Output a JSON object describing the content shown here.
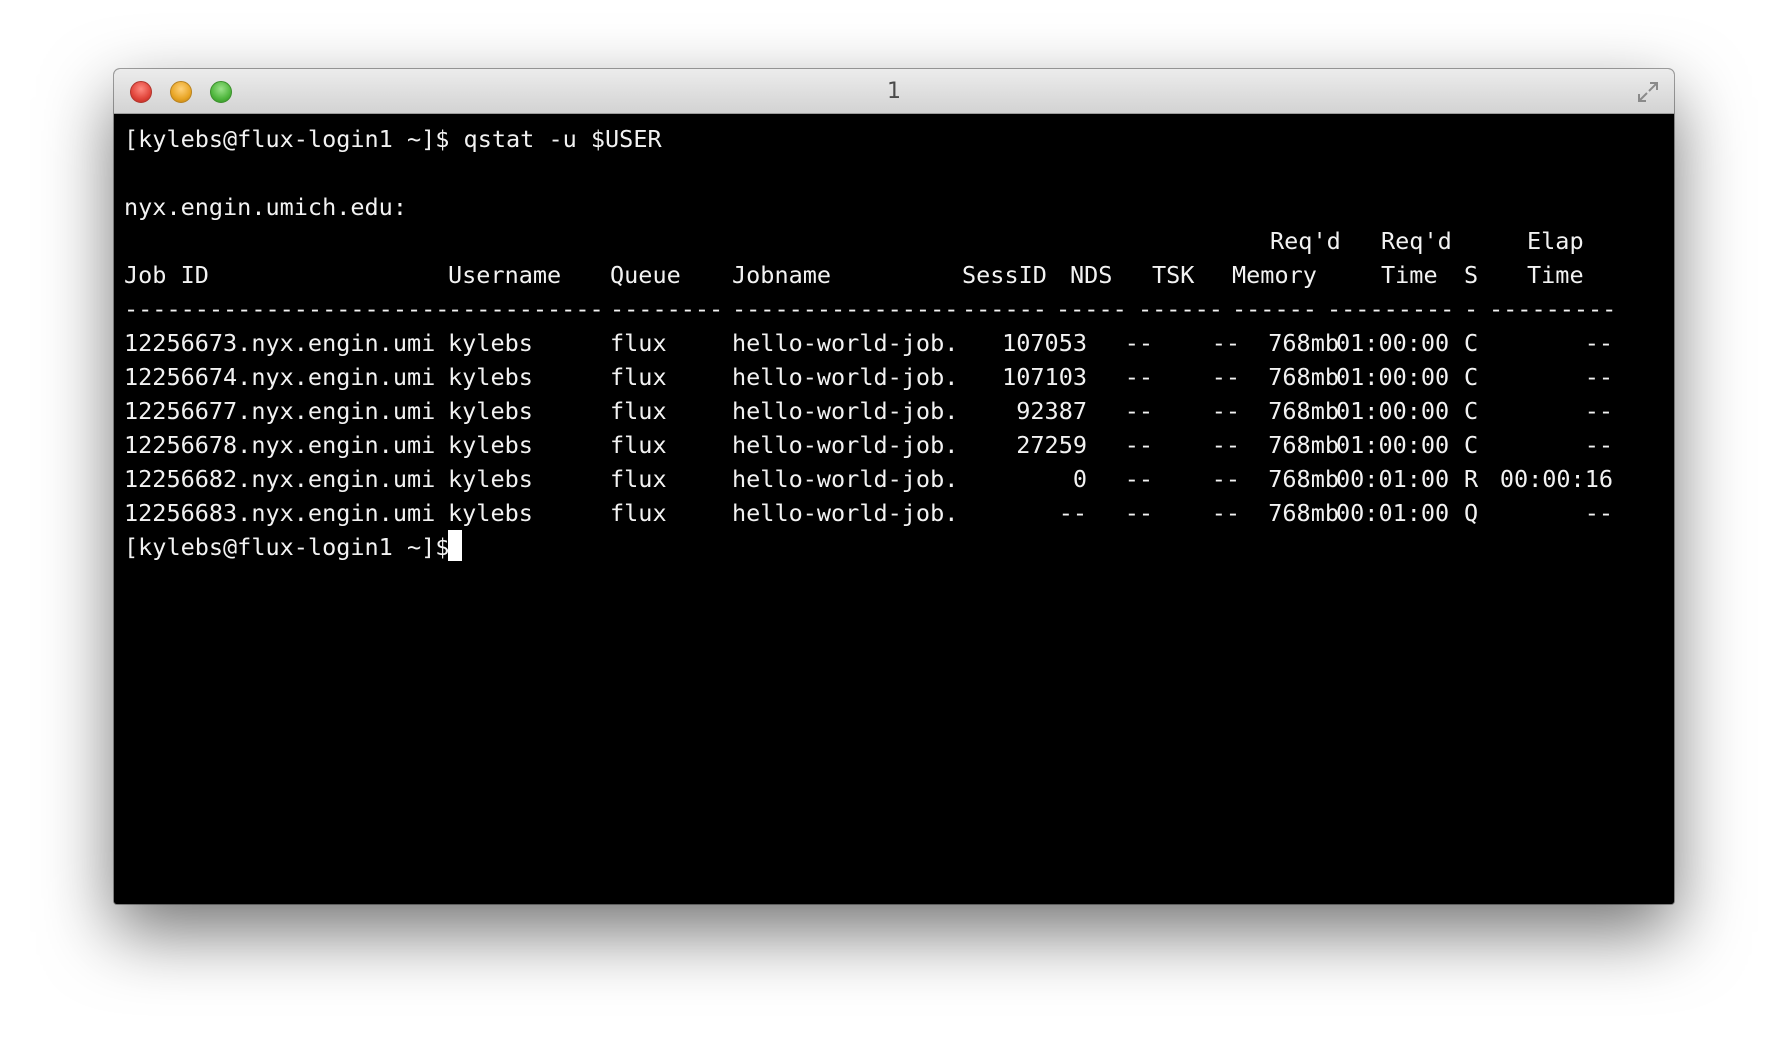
{
  "window": {
    "title": "1"
  },
  "terminal": {
    "command_line": "[kylebs@flux-login1 ~]$ qstat -u $USER",
    "server": "nyx.engin.umich.edu:",
    "header_top": {
      "memory": "Req'd",
      "time": "Req'd",
      "elap": "Elap"
    },
    "header": {
      "job_id": "Job ID",
      "username": "Username",
      "queue": "Queue",
      "jobname": "Jobname",
      "sessid": "SessID",
      "nds": "NDS",
      "tsk": "TSK",
      "memory": "Memory",
      "time": "Time",
      "s": "S",
      "elap": "Time"
    },
    "separator": {
      "job_id": "-----------------------",
      "username": "-----------",
      "queue": "--------",
      "jobname": "----------------",
      "sessid": "------",
      "nds": "-----",
      "tsk": "------",
      "memory": "------",
      "time": "---------",
      "s": "-",
      "elap": "---------"
    },
    "rows": [
      {
        "job_id": "12256673.nyx.engin.umi",
        "username": "kylebs",
        "queue": "flux",
        "jobname": "hello-world-job.",
        "sessid": "107053",
        "nds": "--",
        "tsk": "--",
        "memory": "768mb",
        "time": "01:00:00",
        "s": "C",
        "elap": "--"
      },
      {
        "job_id": "12256674.nyx.engin.umi",
        "username": "kylebs",
        "queue": "flux",
        "jobname": "hello-world-job.",
        "sessid": "107103",
        "nds": "--",
        "tsk": "--",
        "memory": "768mb",
        "time": "01:00:00",
        "s": "C",
        "elap": "--"
      },
      {
        "job_id": "12256677.nyx.engin.umi",
        "username": "kylebs",
        "queue": "flux",
        "jobname": "hello-world-job.",
        "sessid": "92387",
        "nds": "--",
        "tsk": "--",
        "memory": "768mb",
        "time": "01:00:00",
        "s": "C",
        "elap": "--"
      },
      {
        "job_id": "12256678.nyx.engin.umi",
        "username": "kylebs",
        "queue": "flux",
        "jobname": "hello-world-job.",
        "sessid": "27259",
        "nds": "--",
        "tsk": "--",
        "memory": "768mb",
        "time": "01:00:00",
        "s": "C",
        "elap": "--"
      },
      {
        "job_id": "12256682.nyx.engin.umi",
        "username": "kylebs",
        "queue": "flux",
        "jobname": "hello-world-job.",
        "sessid": "0",
        "nds": "--",
        "tsk": "--",
        "memory": "768mb",
        "time": "00:01:00",
        "s": "R",
        "elap": "00:00:16"
      },
      {
        "job_id": "12256683.nyx.engin.umi",
        "username": "kylebs",
        "queue": "flux",
        "jobname": "hello-world-job.",
        "sessid": "--",
        "nds": "--",
        "tsk": "--",
        "memory": "768mb",
        "time": "00:01:00",
        "s": "Q",
        "elap": "--"
      }
    ],
    "prompt": "[kylebs@flux-login1 ~]$"
  },
  "colors": {
    "terminal_bg": "#000000",
    "terminal_fg": "#f2f2f2",
    "close": "#e0443a",
    "minimize": "#e8a525",
    "zoom": "#4fb63d"
  },
  "icons": {
    "close": "close-icon",
    "minimize": "minimize-icon",
    "zoom": "zoom-icon",
    "fullscreen": "fullscreen-arrows-icon"
  }
}
